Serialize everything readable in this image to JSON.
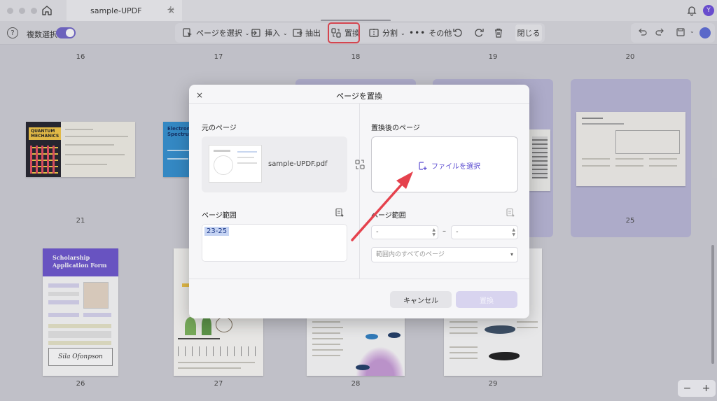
{
  "titlebar": {
    "tab_title": "sample-UPDF",
    "tab_close": "×",
    "tab_add": "+",
    "avatar_initial": "Y"
  },
  "toolbar": {
    "multi_select_label": "複数選択",
    "items": [
      {
        "label": "ページを選択",
        "icon": "cursor-page-icon"
      },
      {
        "label": "挿入",
        "icon": "insert-icon"
      },
      {
        "label": "抽出",
        "icon": "extract-icon"
      },
      {
        "label": "置換",
        "icon": "replace-icon"
      },
      {
        "label": "分割",
        "icon": "split-icon"
      },
      {
        "label": "その他",
        "icon": "more-icon"
      }
    ],
    "close_label": "閉じる"
  },
  "pages": {
    "top_numbers": [
      "16",
      "17",
      "18",
      "19",
      "20"
    ],
    "row1_numbers": [
      "21",
      "25"
    ],
    "bottom_numbers": [
      "26",
      "27",
      "28",
      "29"
    ],
    "quantum_title": "QUANTUM\nMECHANICS",
    "em_title": "Electromag\nSpectru",
    "scholarship_title": "Scholarship\nApplication Form",
    "scholarship_signature": "Sila Ofonpson"
  },
  "dialog": {
    "title": "ページを置換",
    "close": "×",
    "original_label": "元のページ",
    "original_file": "sample-UPDF.pdf",
    "after_label": "置換後のページ",
    "choose_file": "ファイルを選択",
    "range_label_left": "ページ範囲",
    "range_label_right": "ページ範囲",
    "range_value": "23-25",
    "spin_from": "-",
    "spin_to": "-",
    "range_dash": "–",
    "range_select": "範囲内のすべてのページ",
    "cancel": "キャンセル",
    "replace": "置換"
  },
  "zoom": {
    "minus": "−",
    "plus": "+"
  },
  "colors": {
    "accent": "#6a52cf",
    "highlight": "#e5424d",
    "selected_bg": "#b9b7d8"
  }
}
